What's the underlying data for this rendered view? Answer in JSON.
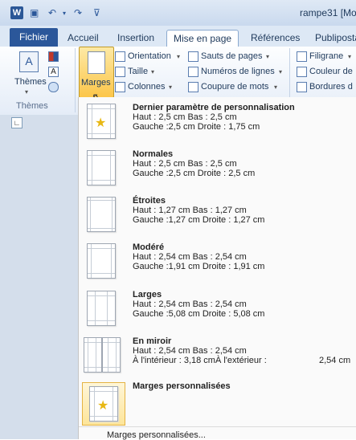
{
  "title_bar": {
    "doc_title": "rampe31 [Mo",
    "app_icon": "W"
  },
  "tabs": [
    {
      "label": "Fichier"
    },
    {
      "label": "Accueil"
    },
    {
      "label": "Insertion"
    },
    {
      "label": "Mise en page"
    },
    {
      "label": "Références"
    },
    {
      "label": "Publiposta"
    }
  ],
  "ribbon": {
    "themes_label": "Thèmes",
    "themes_group": "Thèmes",
    "marges_label": "Marges",
    "orientation": "Orientation",
    "taille": "Taille",
    "colonnes": "Colonnes",
    "sauts": "Sauts de pages",
    "numeros": "Numéros de lignes",
    "coupure": "Coupure de mots",
    "filigrane": "Filigrane",
    "couleur": "Couleur de",
    "bordures": "Bordures d"
  },
  "menu": {
    "items": [
      {
        "title": "Dernier paramètre de personnalisation",
        "line1": "Haut :   2,5 cm        Bas :       2,5 cm",
        "line2": "Gauche :2,5 cm        Droite : 1,75 cm"
      },
      {
        "title": "Normales",
        "line1": "Haut :   2,5 cm        Bas :       2,5 cm",
        "line2": "Gauche :2,5 cm        Droite :  2,5 cm"
      },
      {
        "title": "Étroites",
        "line1": "Haut :   1,27 cm      Bas :       1,27 cm",
        "line2": "Gauche :1,27 cm      Droite :  1,27 cm"
      },
      {
        "title": "Modéré",
        "line1": "Haut :    2,54 cm     Bas :       2,54 cm",
        "line2": "Gauche :1,91 cm      Droite :  1,91 cm"
      },
      {
        "title": "Larges",
        "line1": "Haut :    2,54 cm     Bas :       2,54 cm",
        "line2": "Gauche :5,08 cm      Droite :  5,08 cm"
      },
      {
        "title": "En miroir",
        "line1": "Haut :    2,54 cm     Bas :       2,54 cm",
        "line2": "À l'intérieur :         3,18 cmÀ l'extérieur :",
        "line2_value": "2,54 cm"
      }
    ],
    "custom_title": "Marges personnalisées",
    "footer_link": "Marges personnalisées..."
  }
}
